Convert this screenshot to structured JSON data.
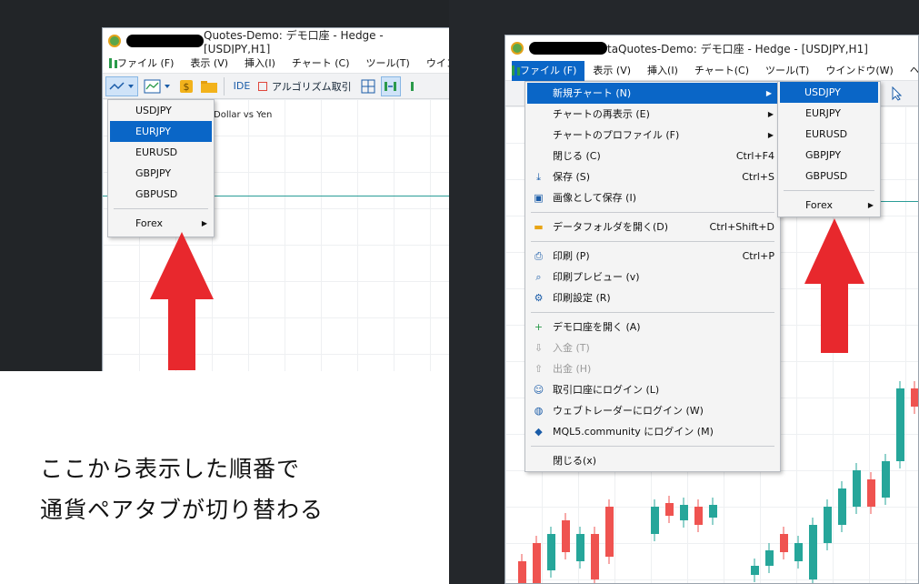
{
  "left": {
    "title": "Quotes-Demo: デモ口座 - Hedge - [USDJPY,H1]",
    "menus": [
      "ファイル (F)",
      "表示 (V)",
      "挿入(I)",
      "チャート (C)",
      "ツール(T)",
      "ウイン"
    ],
    "toolbar": {
      "ide_label": "IDE",
      "algo_label": "アルゴリズム取引"
    },
    "chart_label": "Dollar vs Yen",
    "dropdown": {
      "items": [
        "USDJPY",
        "EURJPY",
        "EURUSD",
        "GBPJPY",
        "GBPUSD"
      ],
      "highlighted": "EURJPY",
      "forex_label": "Forex"
    }
  },
  "caption": {
    "line1": "ここから表示した順番で",
    "line2": "通貨ペアタブが切り替わる"
  },
  "right": {
    "title": "taQuotes-Demo: デモ口座 - Hedge - [USDJPY,H1]",
    "menus": [
      "ファイル (F)",
      "表示 (V)",
      "挿入(I)",
      "チャート(C)",
      "ツール(T)",
      "ウインドウ(W)",
      "ヘ"
    ],
    "file_menu": [
      {
        "label": "新規チャート (N)",
        "shortcut": "",
        "submenu": true,
        "icon": "",
        "highlight": true
      },
      {
        "label": "チャートの再表示 (E)",
        "shortcut": "",
        "submenu": true,
        "icon": ""
      },
      {
        "label": "チャートのプロファイル (F)",
        "shortcut": "",
        "submenu": true,
        "icon": ""
      },
      {
        "label": "閉じる (C)",
        "shortcut": "Ctrl+F4",
        "icon": ""
      },
      {
        "label": "保存 (S)",
        "shortcut": "Ctrl+S",
        "icon": "save-icon"
      },
      {
        "label": "画像として保存 (I)",
        "shortcut": "",
        "icon": "image-icon"
      },
      {
        "divider": true
      },
      {
        "label": "データフォルダを開く(D)",
        "shortcut": "Ctrl+Shift+D",
        "icon": "folder-icon"
      },
      {
        "divider": true
      },
      {
        "label": "印刷 (P)",
        "shortcut": "Ctrl+P",
        "icon": "print-icon"
      },
      {
        "label": "印刷プレビュー (v)",
        "shortcut": "",
        "icon": "print-preview-icon"
      },
      {
        "label": "印刷設定 (R)",
        "shortcut": "",
        "icon": "print-settings-icon"
      },
      {
        "divider": true
      },
      {
        "label": "デモ口座を開く (A)",
        "shortcut": "",
        "icon": "plus-icon"
      },
      {
        "label": "入金 (T)",
        "shortcut": "",
        "icon": "deposit-icon",
        "disabled": true
      },
      {
        "label": "出金 (H)",
        "shortcut": "",
        "icon": "withdraw-icon",
        "disabled": true
      },
      {
        "label": "取引口座にログイン (L)",
        "shortcut": "",
        "icon": "user-icon"
      },
      {
        "label": "ウェブトレーダーにログイン (W)",
        "shortcut": "",
        "icon": "globe-icon"
      },
      {
        "label": "MQL5.community にログイン (M)",
        "shortcut": "",
        "icon": "mql5-icon"
      },
      {
        "divider": true
      },
      {
        "label": "閉じる(x)",
        "shortcut": "",
        "icon": ""
      }
    ],
    "submenu": {
      "items": [
        "USDJPY",
        "EURJPY",
        "EURUSD",
        "GBPJPY",
        "GBPUSD"
      ],
      "highlighted": "USDJPY",
      "forex_label": "Forex"
    }
  },
  "colors": {
    "accent": "#0a66c7",
    "arrow": "#e8282d",
    "bull": "#26a69a",
    "bear": "#ef5350"
  }
}
